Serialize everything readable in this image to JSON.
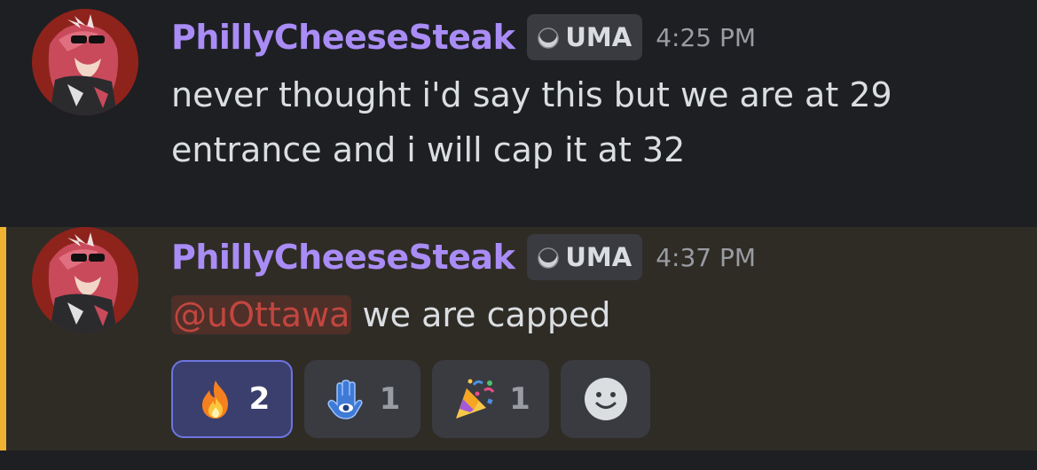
{
  "messages": [
    {
      "username": "PhillyCheeseSteak",
      "tag": "UMA",
      "timestamp": "4:25 PM",
      "lines": [
        "never thought i'd say this but we are at 29",
        "entrance and i will cap it at 32"
      ]
    },
    {
      "username": "PhillyCheeseSteak",
      "tag": "UMA",
      "timestamp": "4:37 PM",
      "mention": "@uOttawa",
      "text": " we are capped",
      "highlighted": true,
      "highlight_color": "#f0b232",
      "reactions": [
        {
          "emoji": "fire-icon",
          "count": "2",
          "active": true
        },
        {
          "emoji": "hamsa-icon",
          "count": "1",
          "active": false
        },
        {
          "emoji": "party-popper-icon",
          "count": "1",
          "active": false
        }
      ]
    }
  ],
  "colors": {
    "background": "#1e1f22",
    "username": "#a98cf5",
    "text": "#dbdee1",
    "timestamp": "#9a9ca3",
    "mention": "#c2463f",
    "reaction_active_bg": "#3b3f6e",
    "reaction_active_border": "#6d75e0"
  }
}
